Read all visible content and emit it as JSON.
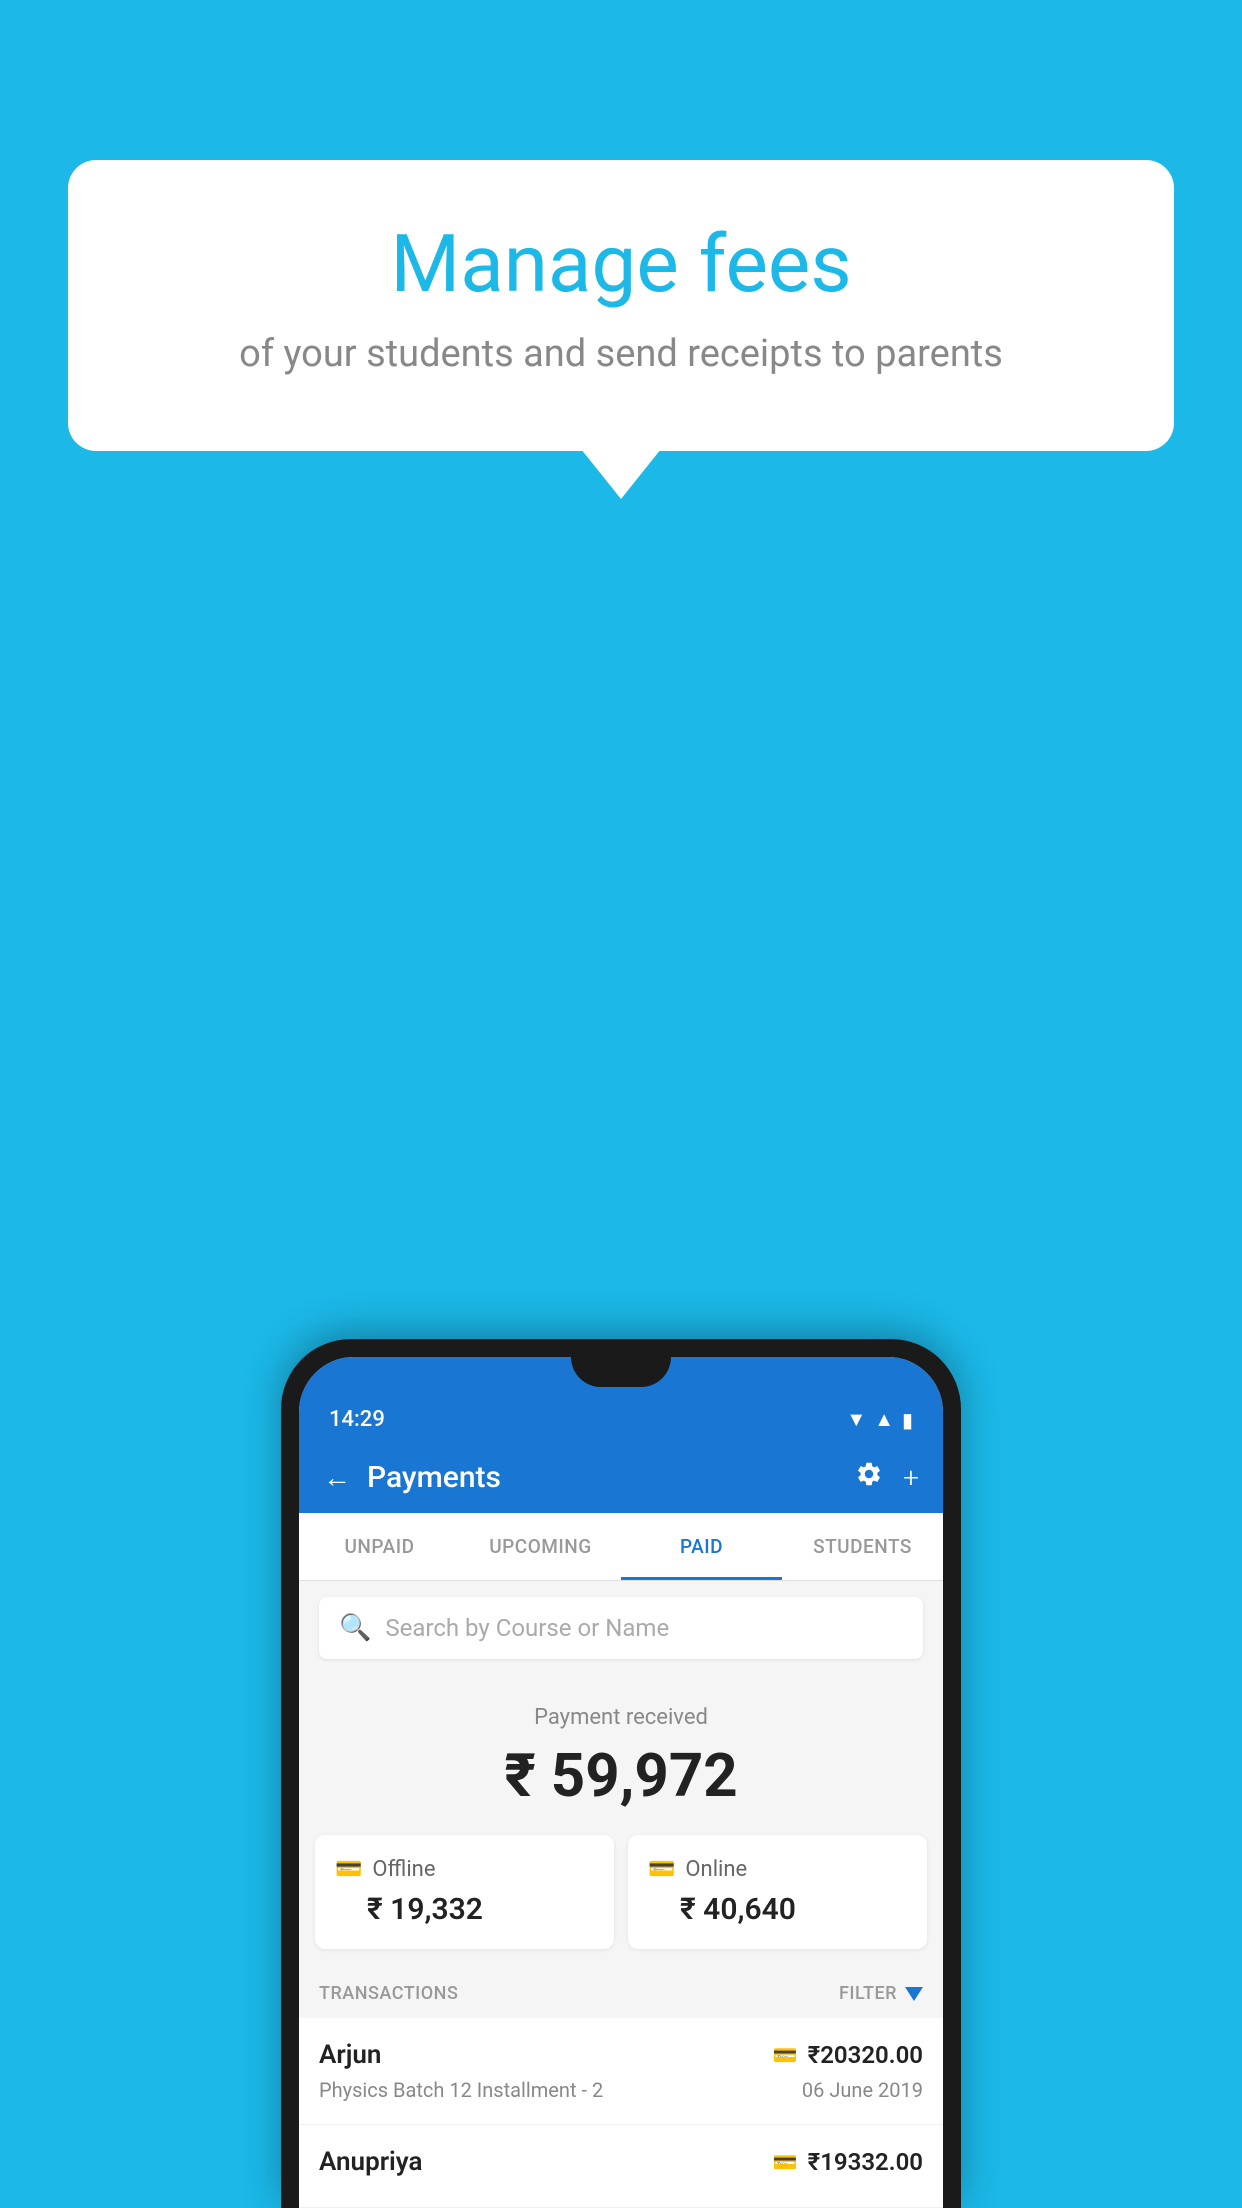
{
  "background_color": "#1bb8e8",
  "bubble": {
    "title": "Manage fees",
    "subtitle": "of your students and send receipts to parents"
  },
  "status_bar": {
    "time": "14:29",
    "icons": "▲◆▮"
  },
  "app_bar": {
    "title": "Payments",
    "back_label": "←",
    "settings_label": "⚙",
    "add_label": "+"
  },
  "tabs": [
    {
      "label": "UNPAID",
      "active": false
    },
    {
      "label": "UPCOMING",
      "active": false
    },
    {
      "label": "PAID",
      "active": true
    },
    {
      "label": "STUDENTS",
      "active": false
    }
  ],
  "search": {
    "placeholder": "Search by Course or Name"
  },
  "payment_received": {
    "label": "Payment received",
    "amount": "₹ 59,972"
  },
  "payment_cards": [
    {
      "label": "Offline",
      "amount": "₹ 19,332",
      "icon": "offline"
    },
    {
      "label": "Online",
      "amount": "₹ 40,640",
      "icon": "online"
    }
  ],
  "transactions_section": {
    "label": "TRANSACTIONS",
    "filter_label": "FILTER"
  },
  "transactions": [
    {
      "name": "Arjun",
      "amount": "₹20320.00",
      "payment_type": "card",
      "course": "Physics Batch 12 Installment - 2",
      "date": "06 June 2019"
    },
    {
      "name": "Anupriya",
      "amount": "₹19332.00",
      "payment_type": "offline",
      "course": "",
      "date": ""
    }
  ]
}
